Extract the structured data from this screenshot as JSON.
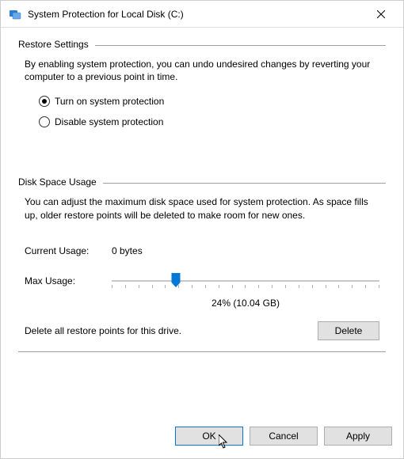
{
  "title": "System Protection for Local Disk (C:)",
  "restore": {
    "section_title": "Restore Settings",
    "description": "By enabling system protection, you can undo undesired changes by reverting your computer to a previous point in time.",
    "opt_on": "Turn on system protection",
    "opt_off": "Disable system protection"
  },
  "disk": {
    "section_title": "Disk Space Usage",
    "description": "You can adjust the maximum disk space used for system protection. As space fills up, older restore points will be deleted to make room for new ones.",
    "current_label": "Current Usage:",
    "current_value": "0 bytes",
    "max_label": "Max Usage:",
    "percent_text": "24% (10.04 GB)",
    "delete_text": "Delete all restore points for this drive.",
    "delete_btn": "Delete"
  },
  "buttons": {
    "ok": "OK",
    "cancel": "Cancel",
    "apply": "Apply"
  }
}
